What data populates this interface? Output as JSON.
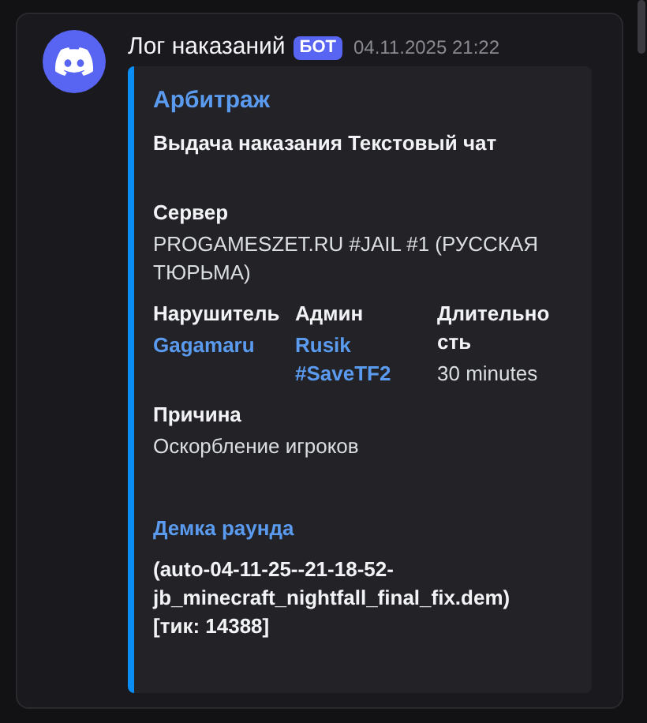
{
  "message": {
    "author": "Лог наказаний",
    "badge": "БОТ",
    "timestamp": "04.11.2025 21:22"
  },
  "embed": {
    "title": "Арбитраж",
    "description": "Выдача наказания Текстовый чат",
    "fields": [
      {
        "name": "Сервер",
        "value": "PROGAMESZET.RU #JAIL #1 (РУССКАЯ ТЮРЬМА)",
        "inline": false,
        "kind": "text"
      },
      {
        "name": "Нарушитель",
        "value": "Gagamaru",
        "inline": true,
        "kind": "mention"
      },
      {
        "name": "Админ",
        "value": "Rusik #SaveTF2",
        "inline": true,
        "kind": "mention"
      },
      {
        "name": "Длительность",
        "value": "30 minutes",
        "inline": true,
        "kind": "text"
      },
      {
        "name": "Причина",
        "value": "Оскорбление игроков",
        "inline": false,
        "kind": "text"
      },
      {
        "name": "Демка раунда",
        "value": "(auto-04-11-25--21-18-52-jb_minecraft_nightfall_final_fix.dem) [тик: 14388]",
        "inline": false,
        "kind": "demo"
      }
    ]
  }
}
